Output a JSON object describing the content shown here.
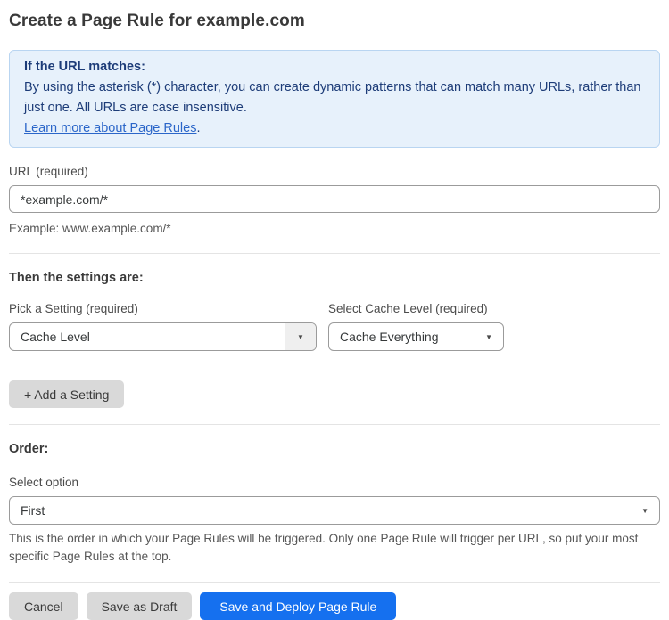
{
  "page": {
    "title": "Create a Page Rule for example.com"
  },
  "info_box": {
    "heading": "If the URL matches:",
    "body": "By using the asterisk (*) character, you can create dynamic patterns that can match many URLs, rather than just one. All URLs are case insensitive.",
    "link_label": "Learn more about Page Rules",
    "link_suffix": "."
  },
  "url_field": {
    "label": "URL (required)",
    "value": "*example.com/*",
    "helper": "Example: www.example.com/*"
  },
  "settings_section": {
    "heading": "Then the settings are:",
    "setting_picker": {
      "label": "Pick a Setting (required)",
      "selected": "Cache Level"
    },
    "cache_level_picker": {
      "label": "Select Cache Level (required)",
      "selected": "Cache Everything"
    },
    "add_setting_label": "+ Add a Setting"
  },
  "order_section": {
    "heading": "Order:",
    "select_label": "Select option",
    "selected": "First",
    "helper": "This is the order in which your Page Rules will be triggered. Only one Page Rule will trigger per URL, so put your most specific Page Rules at the top."
  },
  "actions": {
    "cancel_label": "Cancel",
    "save_draft_label": "Save as Draft",
    "save_deploy_label": "Save and Deploy Page Rule"
  },
  "icons": {
    "dropdown_arrow": "▼"
  },
  "colors": {
    "info_box_background": "#e7f1fb",
    "info_box_border": "#b9d5f1",
    "info_text": "#1d3c78",
    "link_blue": "#2b66c9",
    "primary_button_blue": "#1570ef",
    "secondary_button_gray": "#d9d9d9"
  }
}
